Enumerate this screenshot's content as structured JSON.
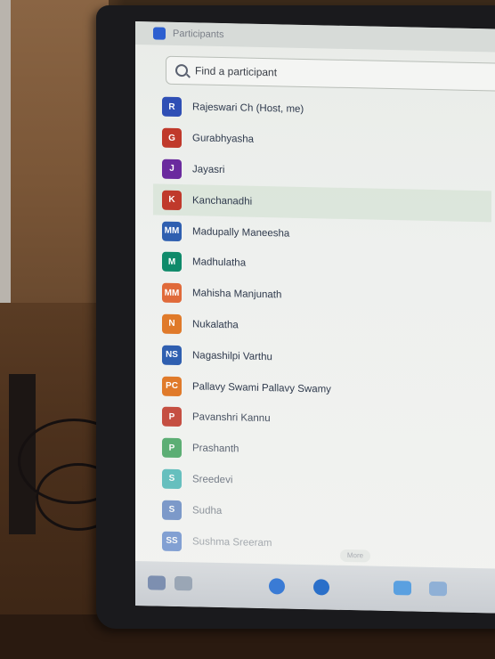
{
  "app": {
    "title": "Participants",
    "logo_color": "#2d5fd0"
  },
  "search": {
    "placeholder": "Find a participant",
    "icon": "search-icon"
  },
  "participants": [
    {
      "initial": "R",
      "name": "Rajeswari Ch (Host, me)",
      "color": "#2f4fb5"
    },
    {
      "initial": "G",
      "name": "Gurabhyasha",
      "color": "#c0392b"
    },
    {
      "initial": "J",
      "name": "Jayasri",
      "color": "#6a2a9e"
    },
    {
      "initial": "K",
      "name": "Kanchanadhi",
      "color": "#c0392b"
    },
    {
      "initial": "MM",
      "name": "Madupally Maneesha",
      "color": "#2f5fb0"
    },
    {
      "initial": "M",
      "name": "Madhulatha",
      "color": "#0f8a6a"
    },
    {
      "initial": "MM",
      "name": "Mahisha Manjunath",
      "color": "#e06a3a"
    },
    {
      "initial": "N",
      "name": "Nukalatha",
      "color": "#e07a2a"
    },
    {
      "initial": "NS",
      "name": "Nagashilpi Varthu",
      "color": "#2f5fb0"
    },
    {
      "initial": "PC",
      "name": "Pallavy Swami Pallavy Swamy",
      "color": "#e07a2a"
    },
    {
      "initial": "P",
      "name": "Pavanshri Kannu",
      "color": "#c0392b"
    },
    {
      "initial": "P",
      "name": "Prashanth",
      "color": "#2e9a4e"
    },
    {
      "initial": "S",
      "name": "Sreedevi",
      "color": "#1aa3a3"
    },
    {
      "initial": "S",
      "name": "Sudha",
      "color": "#2f5fb0"
    },
    {
      "initial": "SS",
      "name": "Sushma Sreeram",
      "color": "#3a6ac0"
    }
  ],
  "taskbar": {
    "more_label": "More"
  }
}
